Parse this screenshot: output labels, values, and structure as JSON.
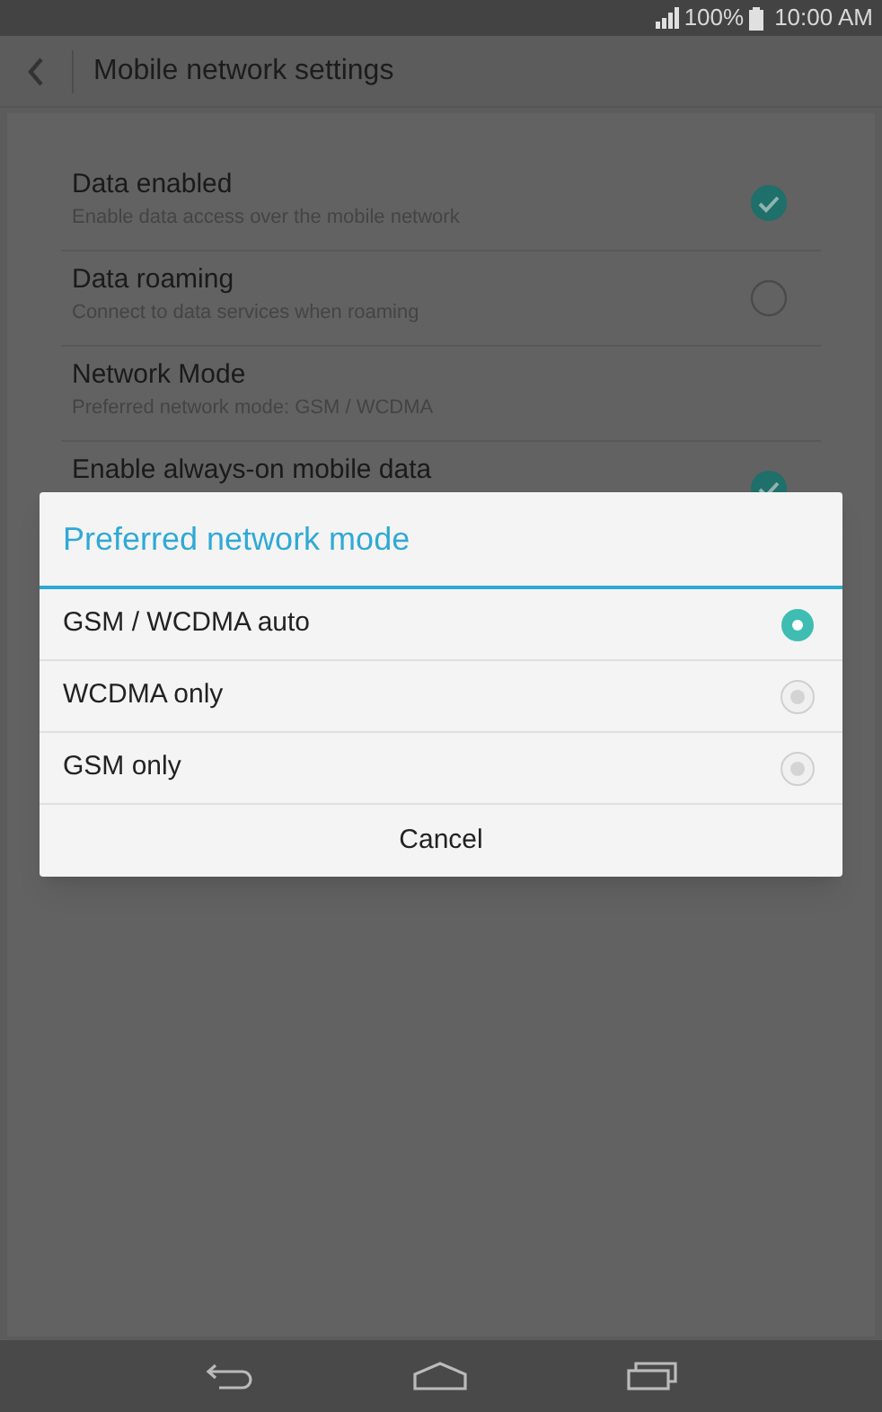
{
  "status_bar": {
    "battery": "100%",
    "time": "10:00 AM"
  },
  "app_bar": {
    "title": "Mobile network settings"
  },
  "settings": [
    {
      "kind": "checkbox",
      "title": "Data enabled",
      "subtitle": "Enable data access over the mobile network",
      "checked": true
    },
    {
      "kind": "checkbox",
      "title": "Data roaming",
      "subtitle": "Connect to data services when roaming",
      "checked": false
    },
    {
      "kind": "plain",
      "title": "Network Mode",
      "subtitle": "Preferred network mode: GSM / WCDMA"
    },
    {
      "kind": "checkbox",
      "title": "Enable always-on mobile data",
      "checked": true
    }
  ],
  "dialog": {
    "title": "Preferred network mode",
    "options": [
      {
        "label": "GSM / WCDMA auto",
        "selected": true
      },
      {
        "label": "WCDMA only",
        "selected": false
      },
      {
        "label": "GSM only",
        "selected": false
      }
    ],
    "cancel": "Cancel"
  }
}
